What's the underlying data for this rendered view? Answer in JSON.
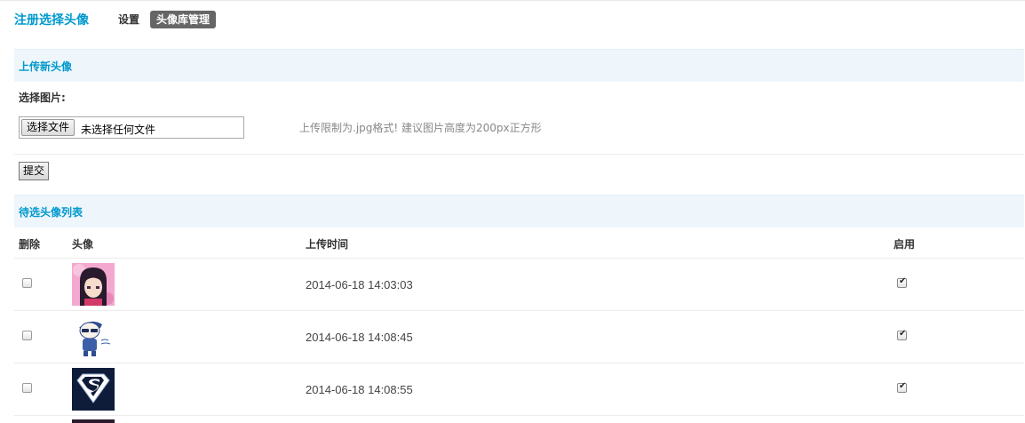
{
  "header": {
    "app_title": "注册选择头像",
    "tabs": [
      {
        "label": "设置",
        "active": false
      },
      {
        "label": "头像库管理",
        "active": true
      }
    ]
  },
  "upload": {
    "section_title": "上传新头像",
    "field_label": "选择图片:",
    "file_button": "选择文件",
    "file_status": "未选择任何文件",
    "hint": "上传限制为.jpg格式! 建议图片高度为200px正方形",
    "submit": "提交"
  },
  "list": {
    "section_title": "待选头像列表",
    "columns": [
      "删除",
      "头像",
      "上传时间",
      "启用"
    ],
    "rows": [
      {
        "avatar": "anime-girl-avatar",
        "uploaded": "2014-06-18 14:03:03",
        "delete_checked": false,
        "enabled": true
      },
      {
        "avatar": "cartoon-boy-avatar",
        "uploaded": "2014-06-18 14:08:45",
        "delete_checked": false,
        "enabled": true
      },
      {
        "avatar": "superman-logo-avatar",
        "uploaded": "2014-06-18 14:08:55",
        "delete_checked": false,
        "enabled": true
      }
    ]
  },
  "colors": {
    "accent": "#0099cc",
    "section_bg": "#eef6fc",
    "active_tab_bg": "#666666"
  }
}
